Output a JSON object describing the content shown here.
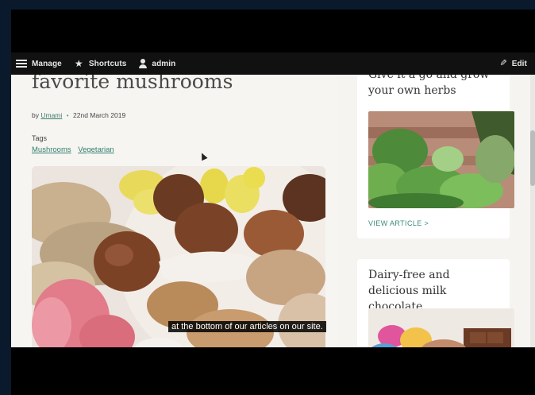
{
  "toolbar": {
    "manage_label": "Manage",
    "shortcuts_label": "Shortcuts",
    "user_label": "admin",
    "edit_label": "Edit"
  },
  "article": {
    "title": "favorite mushrooms",
    "byline_prefix": "by",
    "author": "Umami",
    "date": "22nd March 2019",
    "tags_label": "Tags",
    "tags": [
      "Mushrooms",
      "Vegetarian"
    ]
  },
  "sidebar": {
    "card1": {
      "title": "Give it a go and grow your own herbs",
      "link_label": "VIEW ARTICLE >"
    },
    "card2": {
      "title": "Dairy-free and delicious milk chocolate"
    }
  },
  "subtitle": "at the bottom of our articles on our site.",
  "colors": {
    "accent": "#3c8b7a",
    "toolbar_bg": "#111111",
    "page_bg": "#f7f5f2"
  },
  "icons": [
    "menu-icon",
    "star-icon",
    "user-icon",
    "pencil-icon"
  ]
}
